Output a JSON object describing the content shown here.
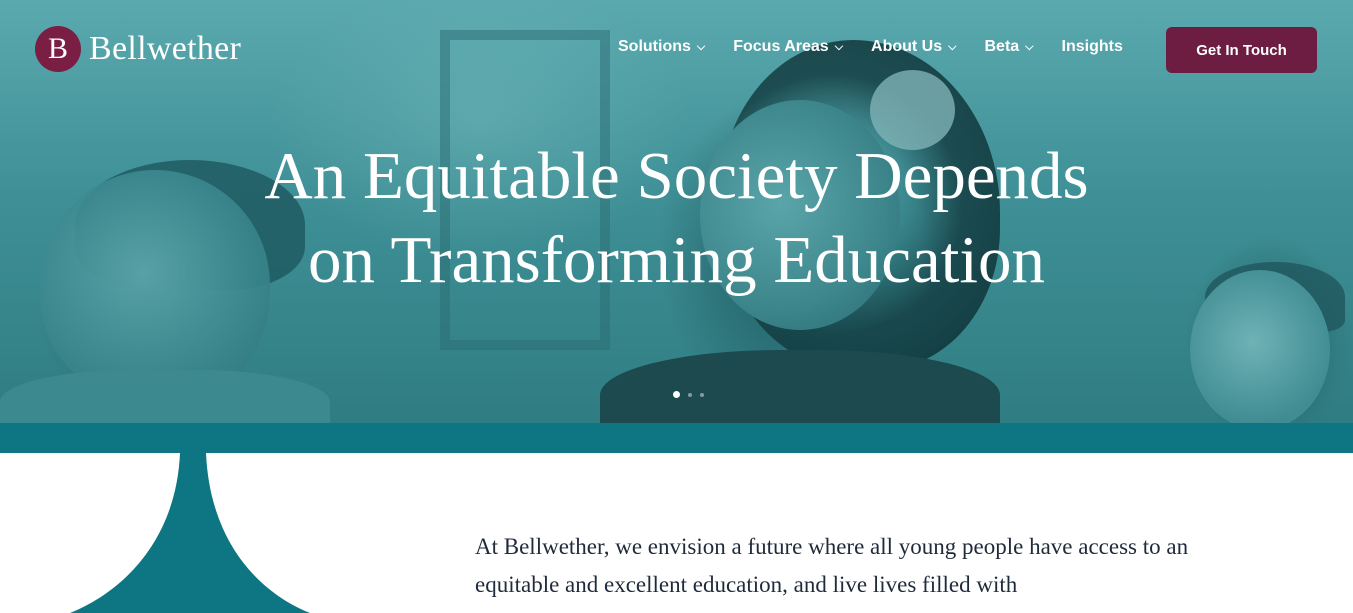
{
  "brand": {
    "logo_letter": "B",
    "name": "Bellwether",
    "color": "#7a1e44"
  },
  "nav": {
    "items": [
      {
        "label": "Solutions",
        "has_dropdown": true
      },
      {
        "label": "Focus Areas",
        "has_dropdown": true
      },
      {
        "label": "About Us",
        "has_dropdown": true
      },
      {
        "label": "Beta",
        "has_dropdown": true
      },
      {
        "label": "Insights",
        "has_dropdown": false
      }
    ],
    "chevron": "⌄",
    "cta_label": "Get In Touch",
    "cta_color": "#6d1c42"
  },
  "hero": {
    "headline_line1": "An Equitable Society Depends",
    "headline_line2": "on Transforming Education",
    "slides": 3,
    "active_slide": 1,
    "overlay_color": "#0d7682"
  },
  "intro": {
    "text": "At Bellwether, we envision a future where all young people have access to an equitable and excellent education, and live lives filled with"
  },
  "colors": {
    "teal": "#0d7682",
    "text": "#1f2a3a"
  }
}
